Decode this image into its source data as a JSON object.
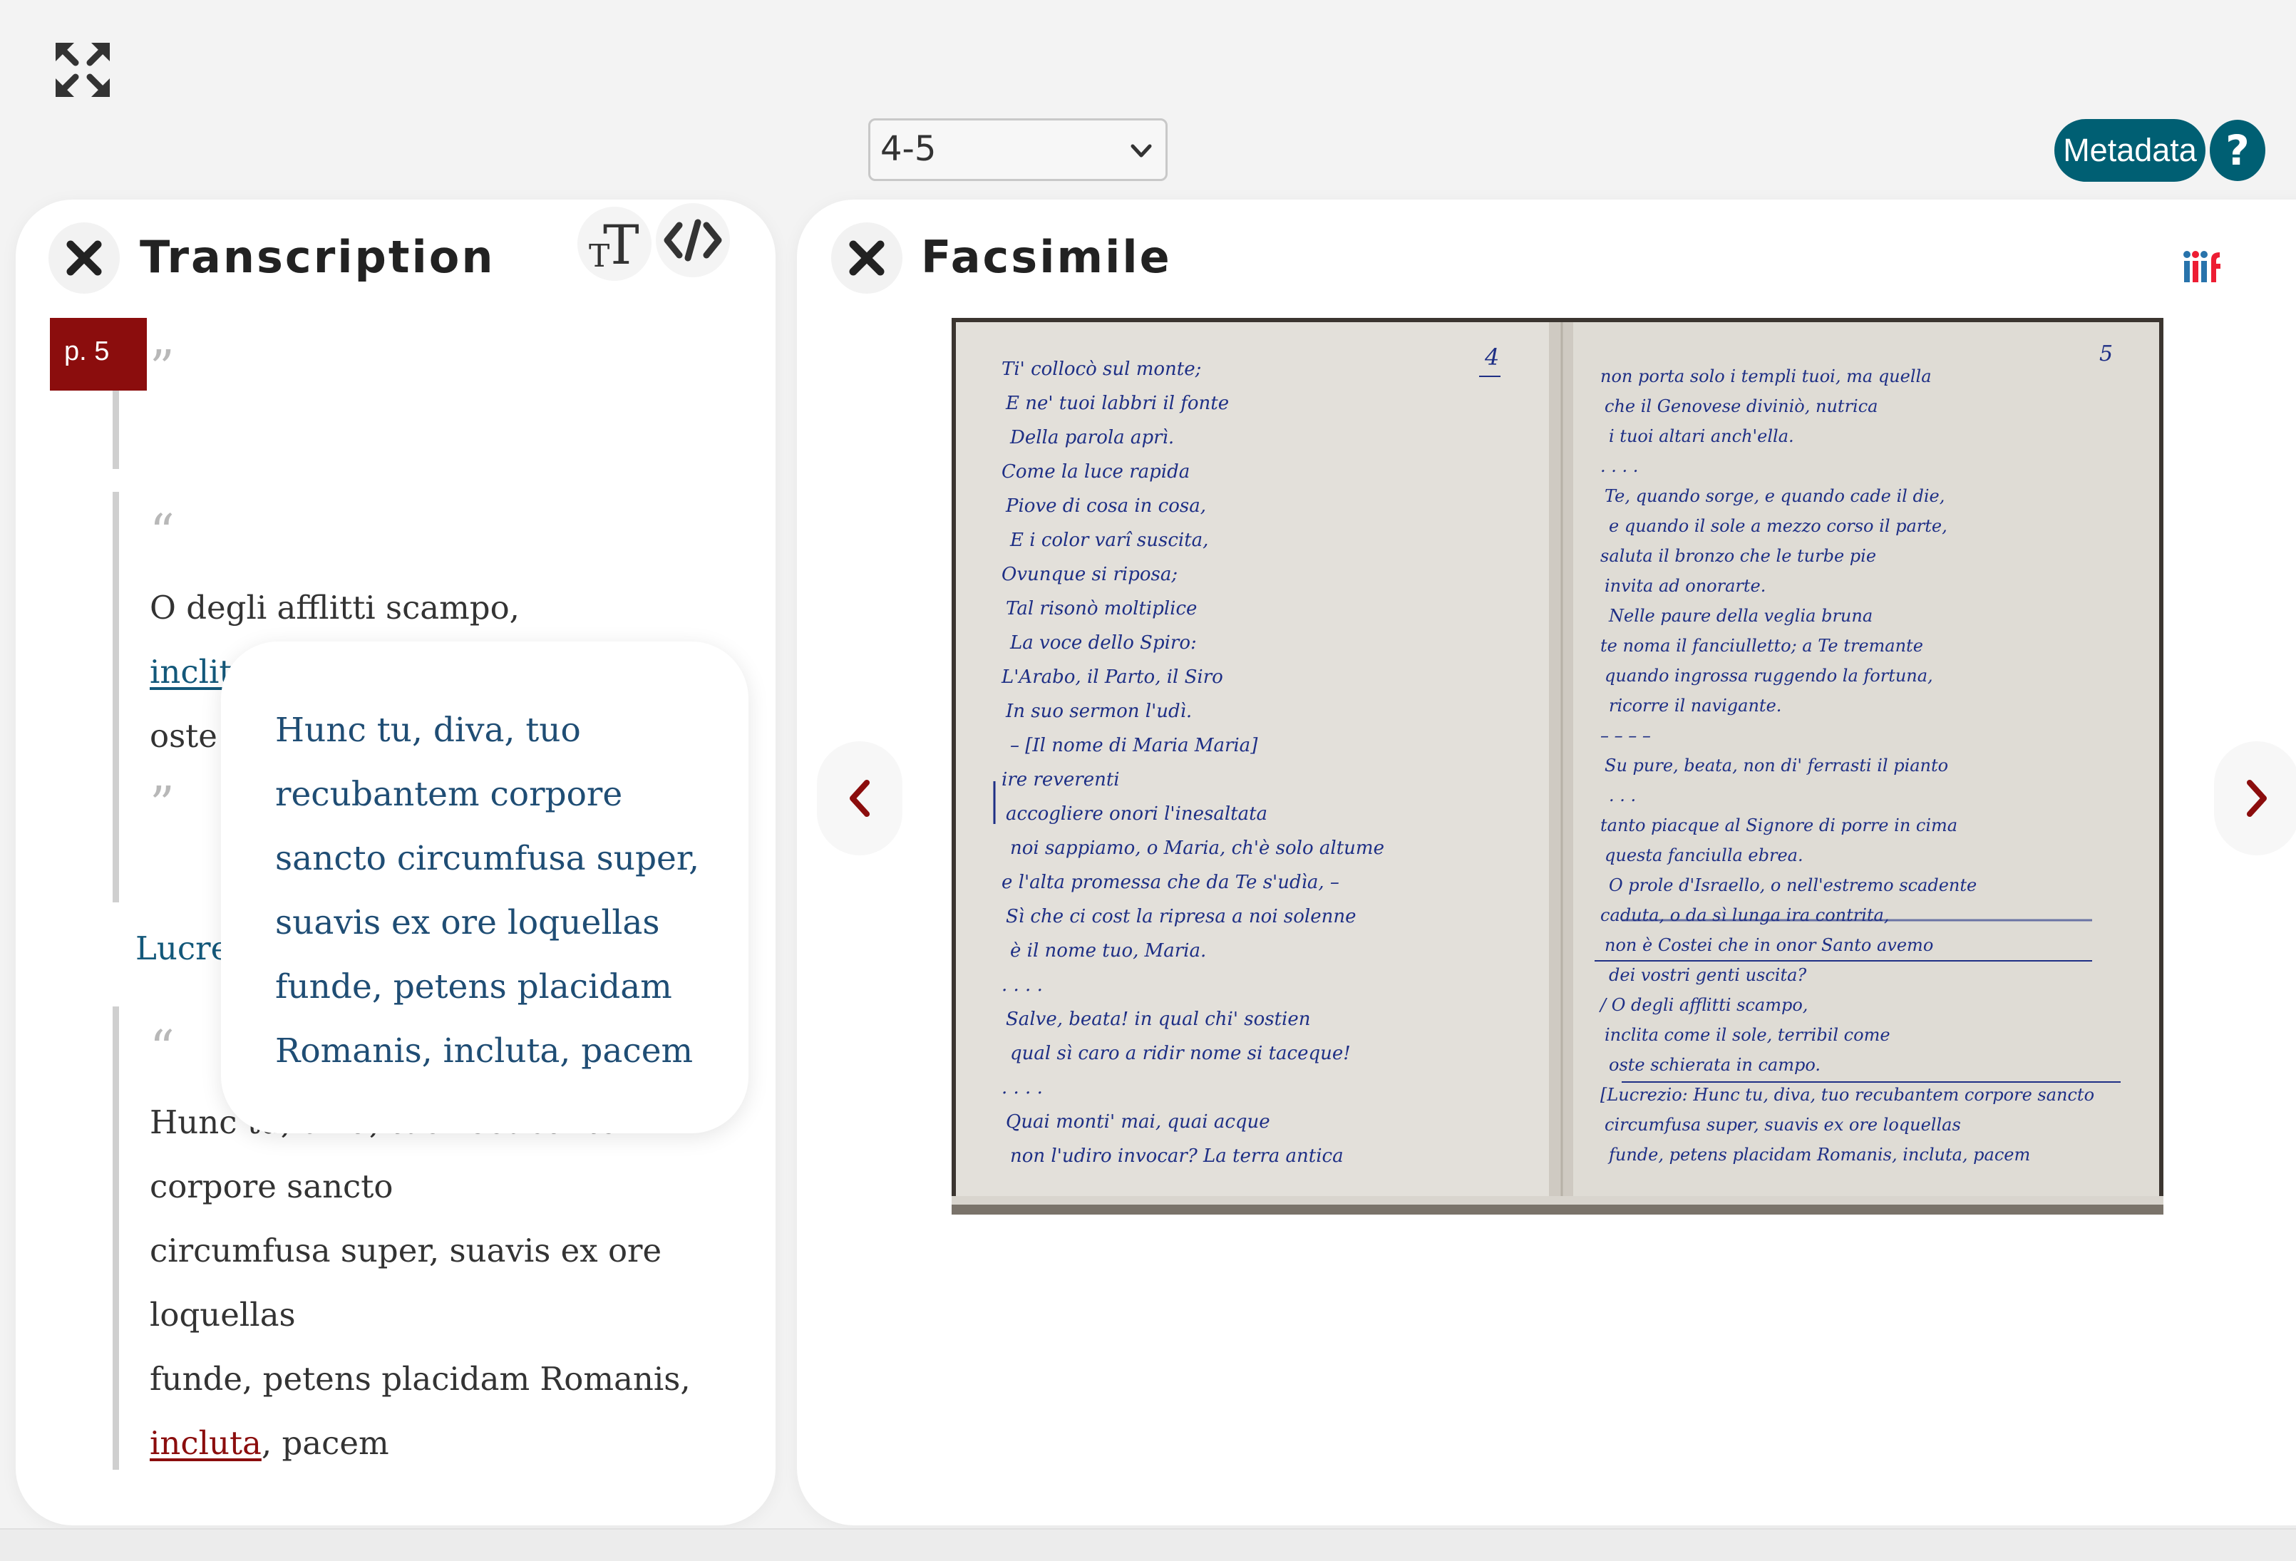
{
  "toolbar": {
    "fullscreen_icon": "fullscreen-icon",
    "page_select": {
      "value": "4-5",
      "options": [
        "4-5"
      ]
    },
    "metadata_label": "Metadata",
    "help_label": "?"
  },
  "transcription": {
    "title": "Transcription",
    "page_badge": "p. 5",
    "open_quote": "“",
    "close_quote": "”",
    "block1": {
      "line1": "O degli afflitti scampo,",
      "line2_link": "inclita",
      "line3_start": "oste"
    },
    "speaker": "Lucrezio:",
    "block2": {
      "line1": "Hunc tu, diva, tuo recubantem",
      "line2": "corpore sancto",
      "line3": "circumfusa super, suavis ex ore",
      "line4": "loquellas",
      "line5_text": "funde, petens placidam Romanis,",
      "line6_link": "incluta",
      "line6_rest": ", pacem"
    },
    "tooltip": [
      "Hunc tu, diva, tuo",
      "recubantem corpore",
      "sancto circumfusa super,",
      "suavis ex ore loquellas",
      "funde, petens placidam",
      "Romanis, incluta, pacem"
    ]
  },
  "facsimile": {
    "title": "Facsimile",
    "iiif_label": "iiif",
    "page_left_number": "4",
    "page_right_number": "5",
    "left_page_lines": [
      "Ti' collocò sul monte;",
      "E ne' tuoi labbri il fonte",
      "Della parola aprì.",
      "Come la luce rapida",
      "Piove di cosa in cosa,",
      "E i color varî suscita,",
      "Ovunque si riposa;",
      "Tal risonò moltiplice",
      "La voce dello Spiro:",
      "L'Arabo, il Parto, il Siro",
      "In suo sermon l'udì.",
      "– [Il nome di Maria Maria]",
      "ire reverenti",
      "accogliere onori l'inesaltata",
      "noi sappiamo, o Maria, ch'è solo altume",
      "e l'alta promessa che da Te s'udìa, –",
      "Sì che ci cost la ripresa a noi solenne",
      "è il nome tuo, Maria.",
      ". . . .",
      "Salve, beata! in qual chi' sostien",
      "qual sì caro a ridir nome si taceque!",
      ". . . .",
      "Quai monti' mai, quai acque",
      "non l'udiro invocar? La terra antica"
    ],
    "right_page_lines": [
      "non porta solo i templi tuoi, ma quella",
      "che il Genovese diviniò, nutrica",
      "i tuoi altari anch'ella.",
      ". . . .",
      "Te, quando sorge, e quando cade il die,",
      "e quando il sole a mezzo corso il parte,",
      "saluta il bronzo che le turbe pie",
      "invita ad onorarte.",
      "Nelle paure della veglia bruna",
      "te noma il fanciulletto; a Te tremante",
      "quando ingrossa ruggendo la fortuna,",
      "ricorre il navigante.",
      "– – – –",
      "Su pure, beata, non di' ferrasti il pianto",
      ". . .",
      "tanto piacque al Signore di porre in cima",
      "questa fanciulla ebrea.",
      "O prole d'Israello, o nell'estremo scadente",
      "caduta, o da sì lunga ira contrita,",
      "non è Costei che in onor Santo avemo",
      "dei vostri genti uscita?",
      "/ O degli afflitti scampo,",
      "inclita come il sole, terribil come",
      "oste schierata in campo.",
      "[Lucrezio: Hunc tu, diva, tuo recubantem corpore sancto",
      "circumfusa super, suavis ex ore loquellas",
      "funde, petens placidam Romanis, incluta, pacem"
    ]
  }
}
